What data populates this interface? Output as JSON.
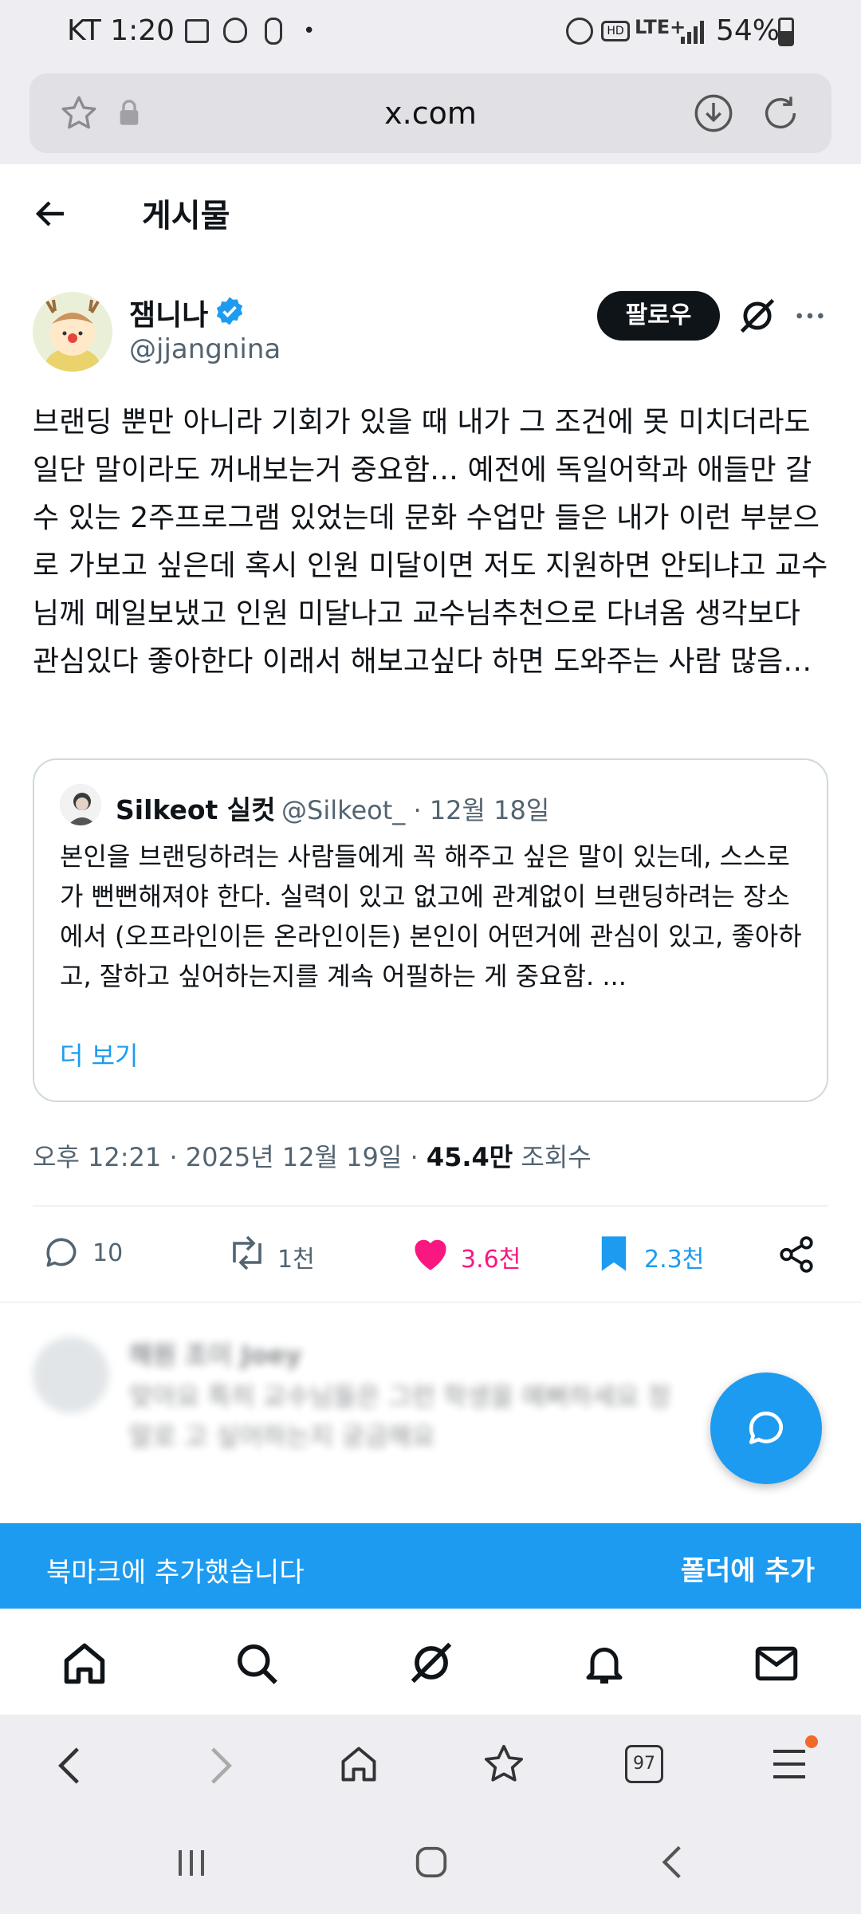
{
  "status_bar": {
    "carrier_time": "KT 1:20",
    "dot": "•",
    "network": "LTE+",
    "battery": "54%"
  },
  "browser": {
    "url": "x.com"
  },
  "header": {
    "title": "게시물"
  },
  "tweet": {
    "author_name": "잼니나",
    "handle": "@jjangnina",
    "follow_label": "팔로우",
    "body": "브랜딩 뿐만 아니라 기회가 있을 때 내가 그 조건에 못 미치더라도 일단 말이라도 꺼내보는거 중요함… 예전에 독일어학과 애들만 갈 수 있는 2주프로그램 있었는데 문화 수업만 들은 내가 이런 부분으로 가보고 싶은데 혹시 인원 미달이면 저도 지원하면 안되냐고 교수님께 메일보냈고 인원 미달나고 교수님추천으로 다녀옴 생각보다 관심있다 좋아한다 이래서 해보고싶다 하면 도와주는 사람 많음…",
    "quote": {
      "name": "Silkeot 실컷",
      "meta": "@Silkeot_ · 12월 18일",
      "body": "본인을 브랜딩하려는 사람들에게 꼭 해주고 싶은 말이 있는데, 스스로가 뻔뻔해져야 한다. 실력이 있고 없고에 관계없이 브랜딩하려는 장소에서 (오프라인이든 온라인이든) 본인이 어떤거에 관심이 있고, 좋아하고, 잘하고 싶어하는지를 계속 어필하는 게 중요함. ...",
      "more": "더 보기"
    },
    "timestamp": "오후 12:21 · 2025년 12월 19일 · ",
    "views_count": "45.4만",
    "views_label": " 조회수",
    "actions": {
      "replies": "10",
      "reposts": "1천",
      "likes": "3.6천",
      "bookmarks": "2.3천"
    },
    "colors": {
      "like": "#f91880",
      "bookmark": "#1d9bf0"
    }
  },
  "reply_preview": {
    "name": "해원 조이 Joey",
    "text": "맞아요 특히 교수님들은 그런 학생을 예뻐하세요 정말로 고 싶어하는지 궁금해요"
  },
  "snackbar": {
    "message": "북마크에 추가했습니다",
    "action": "폴더에 추가"
  },
  "browser_nav": {
    "tab_count": "97"
  },
  "icons": {
    "back": "back-arrow-icon",
    "star": "star-icon",
    "lock": "lock-icon",
    "download": "download-icon",
    "reload": "reload-icon",
    "grok": "grok-icon",
    "more": "more-icon",
    "reply": "reply-icon",
    "repost": "repost-icon",
    "like": "heart-icon",
    "bookmark": "bookmark-icon",
    "share": "share-icon",
    "compose": "compose-icon",
    "home": "home-icon",
    "search": "search-icon",
    "notifications": "bell-icon",
    "messages": "mail-icon"
  }
}
